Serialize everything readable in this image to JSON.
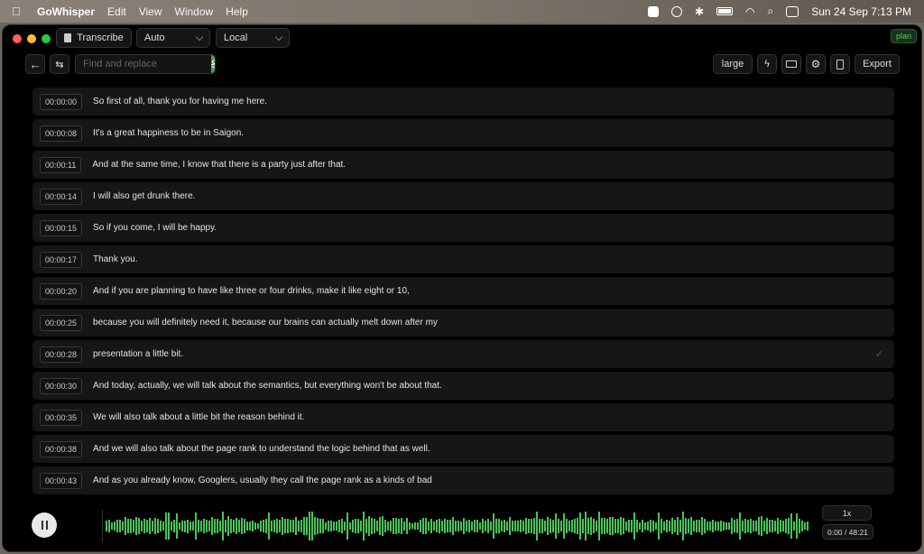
{
  "menubar": {
    "app": "GoWhisper",
    "items": [
      "Edit",
      "View",
      "Window",
      "Help"
    ],
    "clock": "Sun 24 Sep  7:13 PM"
  },
  "toolbar": {
    "transcribe": "Transcribe",
    "language": "Auto",
    "engine": "Local",
    "search_placeholder": "Find and replace",
    "model": "large",
    "export": "Export",
    "plan_badge": "plan"
  },
  "transcript": [
    {
      "time": "00:00:00",
      "text": "So first of all, thank you for having me here."
    },
    {
      "time": "00:00:08",
      "text": "It's a great happiness to be in Saigon."
    },
    {
      "time": "00:00:11",
      "text": "And at the same time, I know that there is a party just after that."
    },
    {
      "time": "00:00:14",
      "text": "I will also get drunk there."
    },
    {
      "time": "00:00:15",
      "text": "So if you come, I will be happy."
    },
    {
      "time": "00:00:17",
      "text": "Thank you."
    },
    {
      "time": "00:00:20",
      "text": "And if you are planning to have like three or four drinks, make it like eight or 10,"
    },
    {
      "time": "00:00:25",
      "text": "because you will definitely need it, because our brains can actually melt down after my"
    },
    {
      "time": "00:00:28",
      "text": "presentation a little bit.",
      "checked": true
    },
    {
      "time": "00:00:30",
      "text": "And today, actually, we will talk about the semantics, but everything won't be about that."
    },
    {
      "time": "00:00:35",
      "text": "We will also talk about a little bit the reason behind it."
    },
    {
      "time": "00:00:38",
      "text": "And we will also talk about the page rank to understand the logic behind that as well."
    },
    {
      "time": "00:00:43",
      "text": "And as you already know, Googlers, usually they call the page rank as a kinds of bad"
    }
  ],
  "player": {
    "speed": "1x",
    "time": "0:00 / 48:21",
    "state": "playing"
  },
  "colors": {
    "accent": "#3fa34d",
    "waveform": "#4cc35a",
    "background": "#000000",
    "row": "#161616"
  }
}
